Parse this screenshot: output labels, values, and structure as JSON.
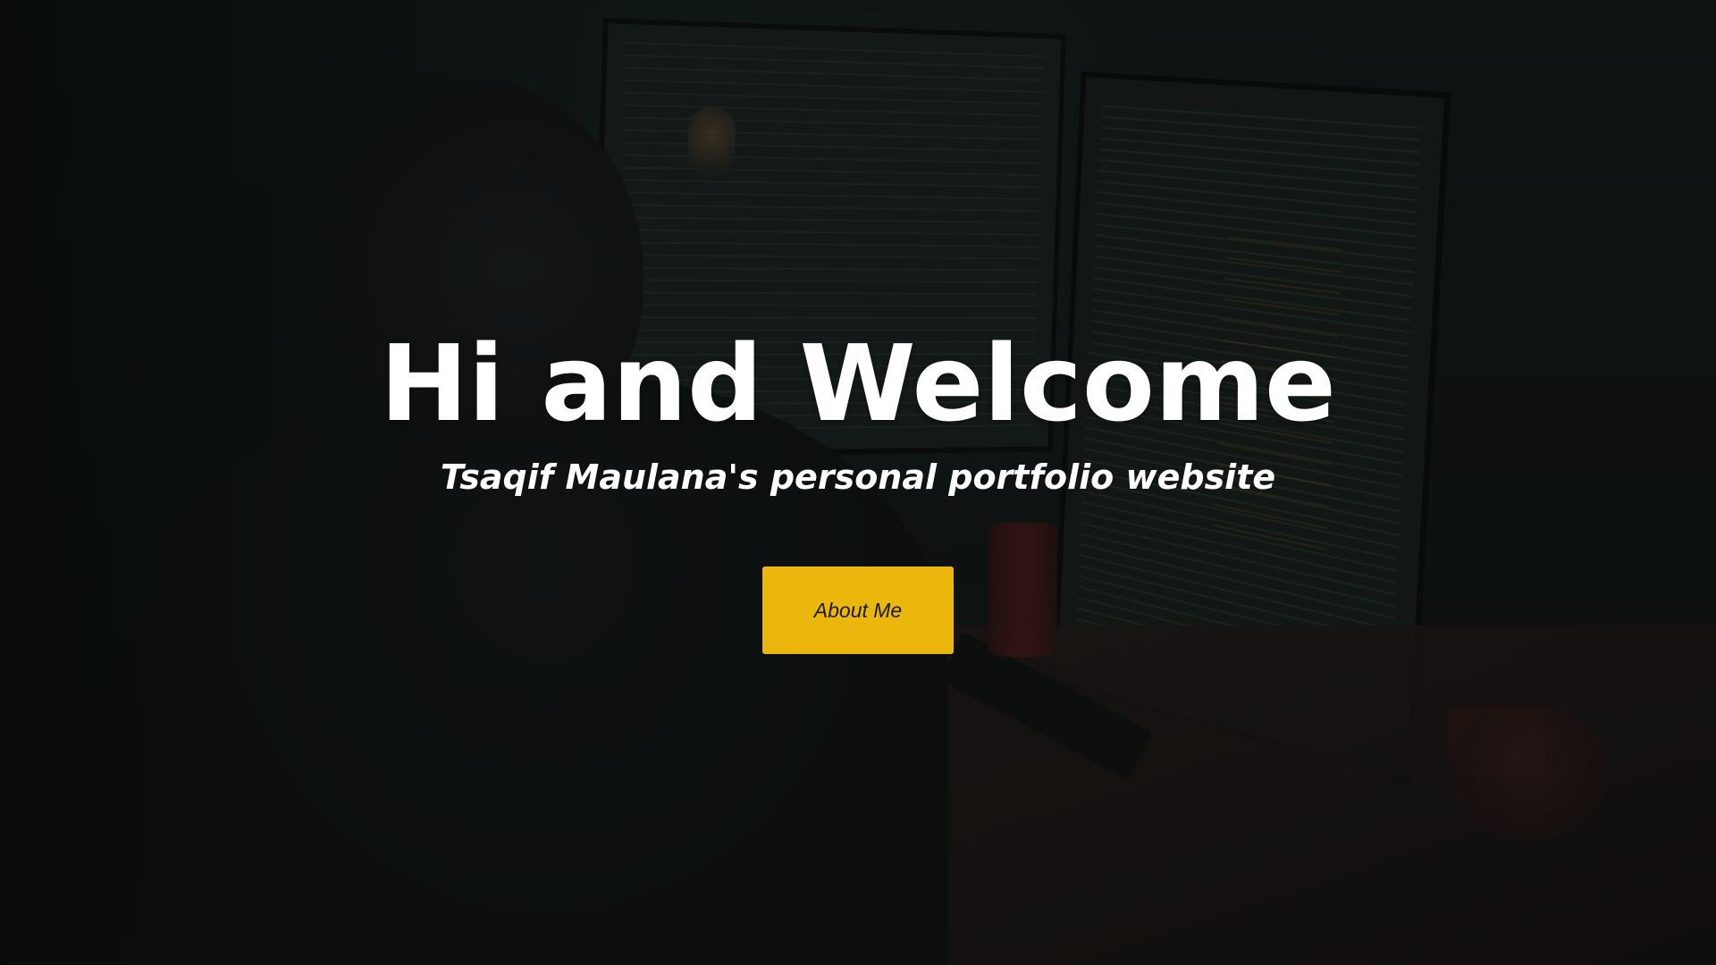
{
  "hero": {
    "title": "Hi and Welcome",
    "subtitle": "Tsaqif Maulana's personal portfolio website",
    "cta_label": "About Me"
  },
  "colors": {
    "accent": "#ecb70c",
    "background": "#121614",
    "text": "#ffffff"
  }
}
